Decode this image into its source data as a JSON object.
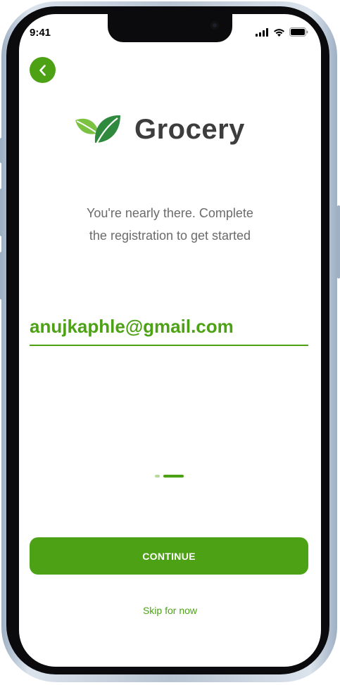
{
  "status_bar": {
    "time": "9:41",
    "icons": [
      "signal-icon",
      "wifi-icon",
      "battery-icon"
    ]
  },
  "header": {
    "back_icon": "chevron-left-icon"
  },
  "brand": {
    "name": "Grocery",
    "logo_icon": "leaf-icon"
  },
  "intro": {
    "line1": "You're nearly there. Complete",
    "line2": "the registration to get started"
  },
  "form": {
    "email_value": "anujkaphle@gmail.com"
  },
  "pager": {
    "total_steps": 2,
    "current_step": 2
  },
  "actions": {
    "continue_label": "CONTINUE",
    "skip_label": "Skip for now"
  },
  "colors": {
    "accent": "#4ca214",
    "text_dark": "#3d3d3d",
    "text_muted": "#6b6b6b"
  }
}
